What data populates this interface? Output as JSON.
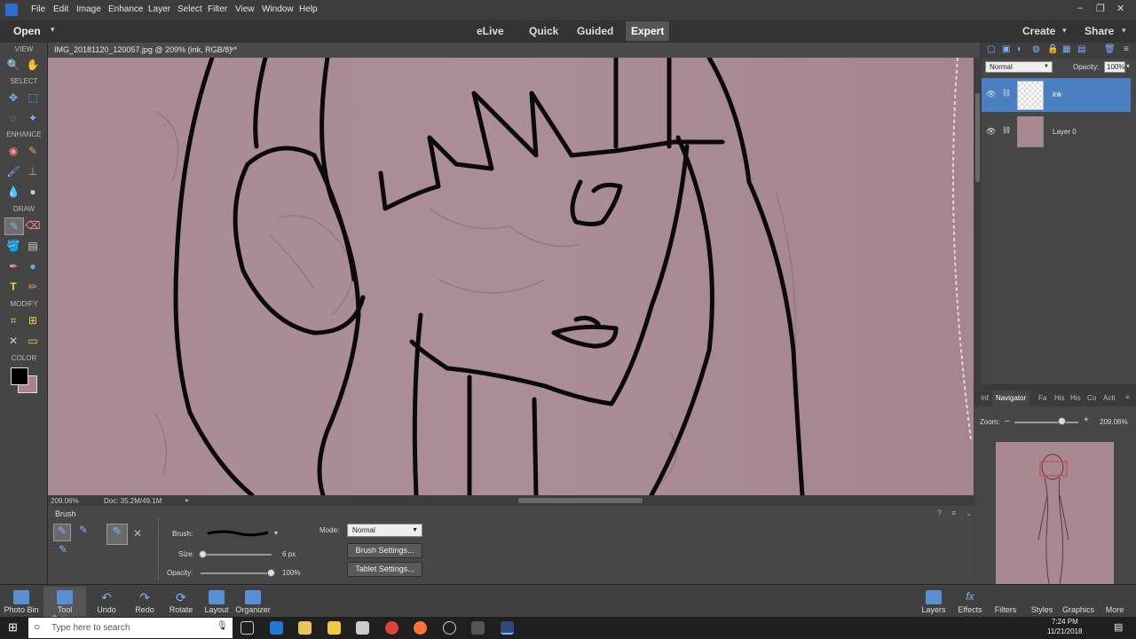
{
  "menubar": {
    "items": [
      "File",
      "Edit",
      "Image",
      "Enhance",
      "Layer",
      "Select",
      "Filter",
      "View",
      "Window",
      "Help"
    ]
  },
  "modebar": {
    "open": "Open",
    "modes": [
      "eLive",
      "Quick",
      "Guided",
      "Expert"
    ],
    "create": "Create",
    "share": "Share"
  },
  "toolbox": {
    "sections": [
      "VIEW",
      "SELECT",
      "ENHANCE",
      "DRAW",
      "MODIFY",
      "COLOR"
    ]
  },
  "document": {
    "title": "IMG_20181120_120057.jpg @ 209% (ink, RGB/8) *",
    "zoom": "209.06%",
    "doc_size": "Doc: 35.2M/49.1M"
  },
  "tool_options": {
    "tool_name": "Brush",
    "brush_label": "Brush:",
    "size_label": "Size:",
    "size_value": "6 px",
    "opacity_label": "Opacity:",
    "opacity_value": "100%",
    "mode_label": "Mode:",
    "mode_value": "Normal",
    "brush_settings": "Brush Settings...",
    "tablet_settings": "Tablet Settings..."
  },
  "layers": {
    "blend_mode": "Normal",
    "opacity_label": "Opacity:",
    "opacity_value": "100%",
    "items": [
      {
        "name": "ink"
      },
      {
        "name": "Layer 0"
      }
    ]
  },
  "navigator": {
    "tabs": [
      "Inf",
      "Navigator",
      "Fa",
      "His",
      "His",
      "Co",
      "Acti"
    ],
    "zoom_label": "Zoom:",
    "zoom_value": "209.06%"
  },
  "taskbar": {
    "left_items": [
      "Photo Bin",
      "Tool Options",
      "Undo",
      "Redo",
      "Rotate",
      "Layout",
      "Organizer"
    ],
    "right_items": [
      "Layers",
      "Effects",
      "Filters",
      "Styles",
      "Graphics",
      "More"
    ]
  },
  "windows": {
    "search_placeholder": "Type here to search",
    "time": "7:24 PM",
    "date": "11/21/2018"
  },
  "colors": {
    "accent": "#4a7fc1",
    "canvas": "#a88891",
    "foreground": "#000000",
    "background": "#a8838c"
  }
}
